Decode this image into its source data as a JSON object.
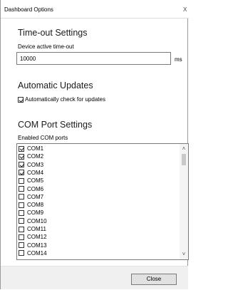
{
  "window": {
    "title": "Dashboard Options",
    "close_glyph": "X"
  },
  "timeout": {
    "heading": "Time-out Settings",
    "label": "Device active time-out",
    "value": "10000",
    "unit": "ms"
  },
  "updates": {
    "heading": "Automatic Updates",
    "auto_check_label": "Automatically check for updates",
    "auto_check_checked": true
  },
  "com": {
    "heading": "COM Port Settings",
    "label": "Enabled COM ports",
    "ports": [
      {
        "label": "COM1",
        "checked": true
      },
      {
        "label": "COM2",
        "checked": true
      },
      {
        "label": "COM3",
        "checked": true
      },
      {
        "label": "COM4",
        "checked": true
      },
      {
        "label": "COM5",
        "checked": false
      },
      {
        "label": "COM6",
        "checked": false
      },
      {
        "label": "COM7",
        "checked": false
      },
      {
        "label": "COM8",
        "checked": false
      },
      {
        "label": "COM9",
        "checked": false
      },
      {
        "label": "COM10",
        "checked": false
      },
      {
        "label": "COM11",
        "checked": false
      },
      {
        "label": "COM12",
        "checked": false
      },
      {
        "label": "COM13",
        "checked": false
      },
      {
        "label": "COM14",
        "checked": false
      }
    ],
    "scroll_up_glyph": "˄",
    "scroll_down_glyph": "˅"
  },
  "footer": {
    "close_label": "Close"
  }
}
